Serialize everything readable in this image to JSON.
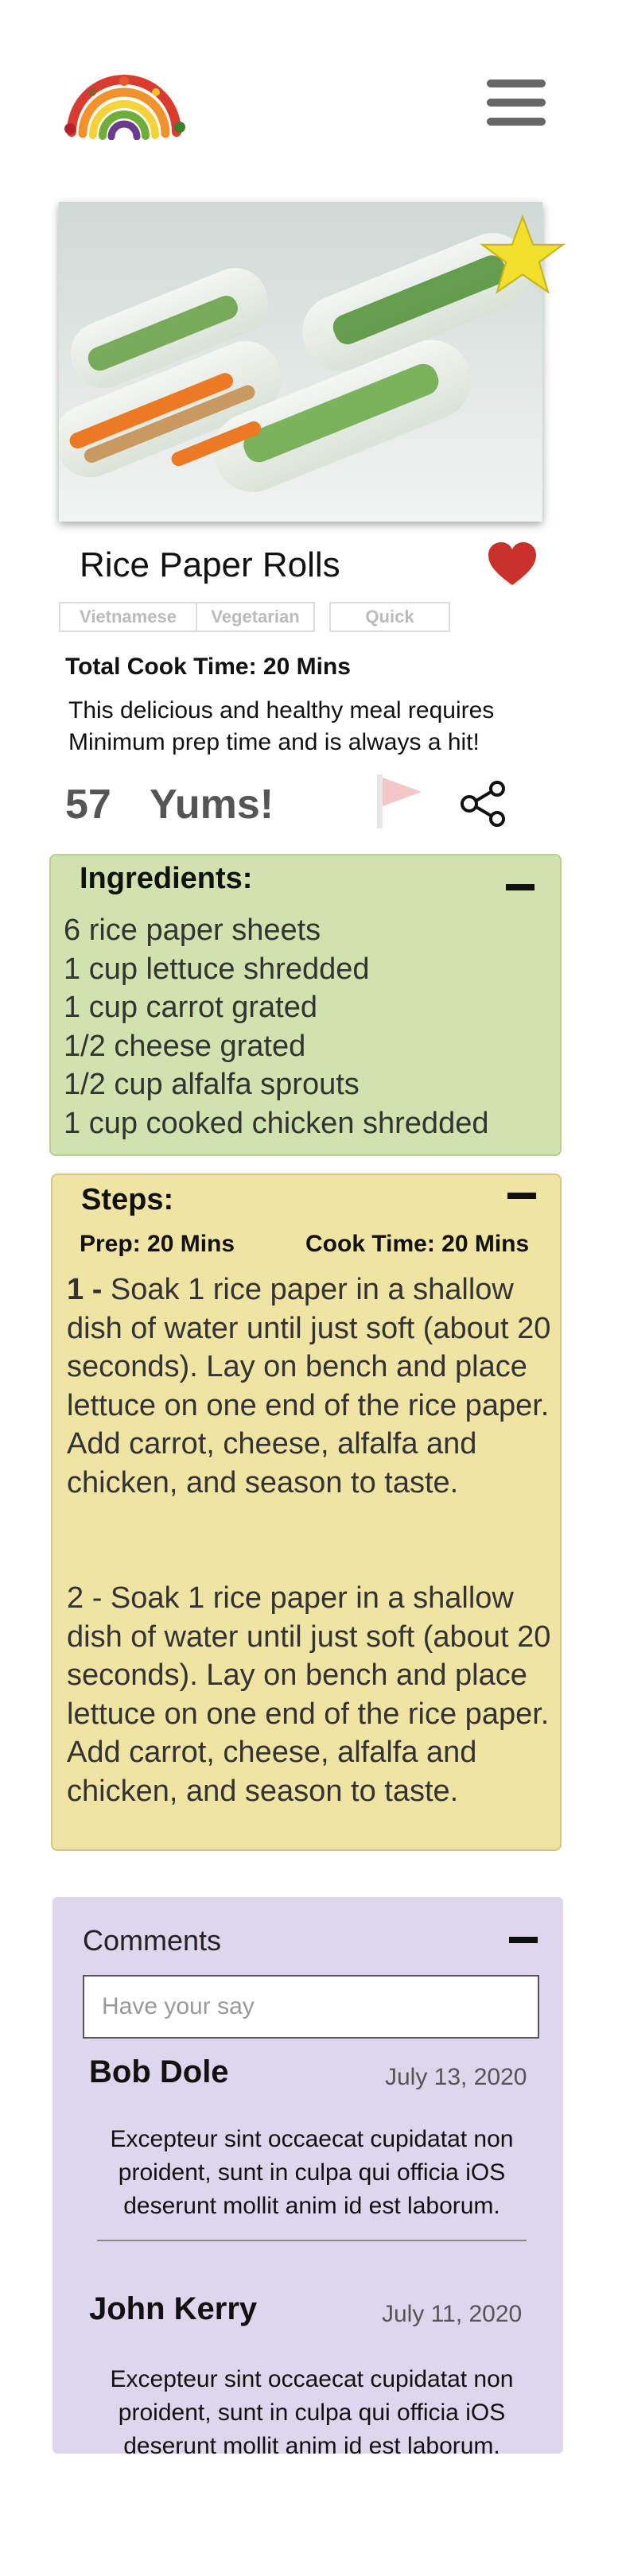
{
  "header": {
    "logo_icon": "rainbow-vegetable-logo",
    "menu_icon": "hamburger-menu-icon"
  },
  "recipe": {
    "title": "Rice Paper Rolls",
    "favorite_icon": "star-icon",
    "like_icon": "heart-icon",
    "tags": [
      "Vietnamese",
      "Vegetarian",
      "Quick"
    ],
    "total_cook_time": "Total Cook Time: 20 Mins",
    "description": "This delicious and healthy meal requires Minimum prep time and is always a hit!",
    "yums_count": "57",
    "yums_label": "Yums!",
    "flag_icon": "flag-icon",
    "share_icon": "share-icon",
    "colors": {
      "heart": "#c8322b",
      "star": "#f2e02c",
      "flag": "#f4c6c6"
    }
  },
  "ingredients": {
    "heading": "Ingredients:",
    "items": [
      "6 rice paper sheets",
      "1 cup lettuce shredded",
      "1 cup carrot grated",
      "1/2 cheese grated",
      "1/2 cup alfalfa sprouts",
      "1 cup cooked chicken shredded"
    ],
    "color": "#d0e2ad"
  },
  "steps": {
    "heading": "Steps:",
    "prep": "Prep: 20 Mins",
    "cook": "Cook Time: 20 Mins",
    "step1_num": "1 -",
    "step1_text": " Soak 1 rice paper in a shallow dish of water until just soft (about 20 seconds). Lay on bench and place lettuce on one end of the rice paper. Add carrot, cheese, alfalfa and chicken, and season to taste.",
    "step2_text": "2 - Soak 1 rice paper in a shallow dish of water until just soft (about 20 seconds). Lay on bench and place lettuce on one end of the rice paper. Add carrot, cheese, alfalfa and chicken, and season to taste.",
    "color": "#f0e4a4"
  },
  "comments": {
    "heading": "Comments",
    "placeholder": "Have your say",
    "items": [
      {
        "name": "Bob Dole",
        "date": "July 13, 2020",
        "text": "Excepteur sint occaecat cupidatat non proident, sunt in culpa qui officia iOS deserunt mollit anim id est laborum."
      },
      {
        "name": "John Kerry",
        "date": "July 11, 2020",
        "text": "Excepteur sint occaecat cupidatat non proident, sunt in culpa qui officia iOS deserunt mollit anim id est laborum."
      }
    ],
    "color": "#ddd6ec"
  }
}
